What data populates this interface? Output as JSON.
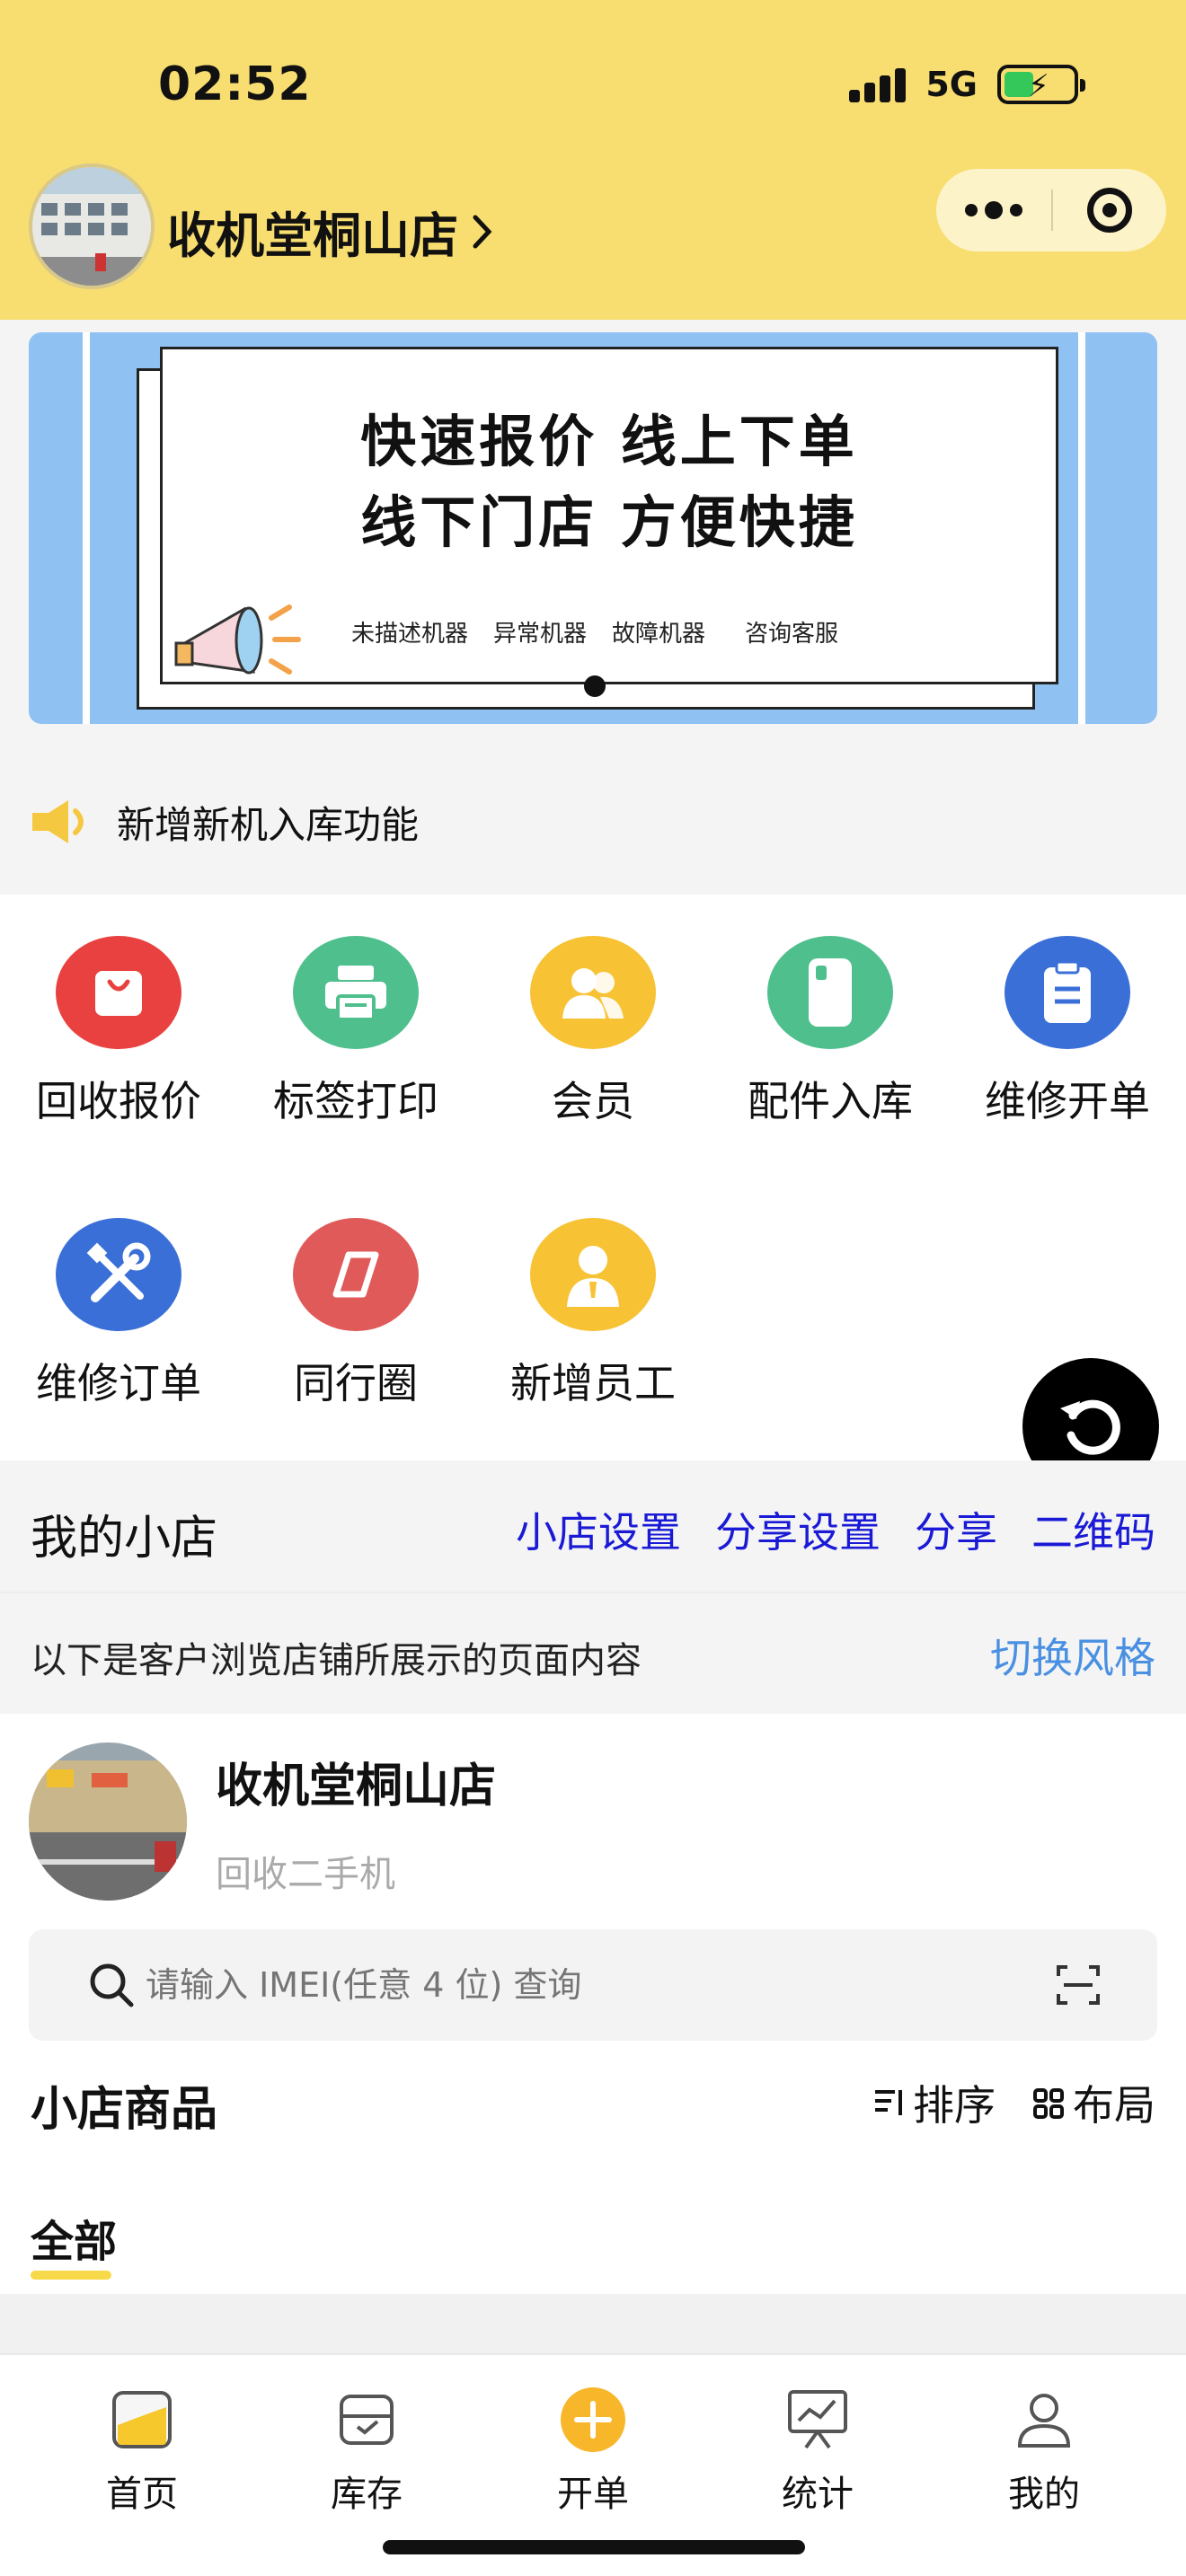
{
  "status_bar": {
    "time": "02:52",
    "network": "5G"
  },
  "header": {
    "store_name": "收机堂桐山店",
    "chevron": "›"
  },
  "banner": {
    "line1": "快速报价  线上下单",
    "line2": "线下门店  方便快捷",
    "tags": [
      "未描述机器",
      "异常机器",
      "故障机器",
      "咨询客服"
    ]
  },
  "notice": {
    "text": "新增新机入库功能",
    "icon": "speaker-icon"
  },
  "grid": {
    "items": [
      {
        "label": "回收报价",
        "icon": "bag-icon",
        "color": "#e8413f"
      },
      {
        "label": "标签打印",
        "icon": "printer-icon",
        "color": "#4fbf8d"
      },
      {
        "label": "会员",
        "icon": "members-icon",
        "color": "#f7c234"
      },
      {
        "label": "配件入库",
        "icon": "phone-icon",
        "color": "#4fbf8d"
      },
      {
        "label": "维修开单",
        "icon": "clipboard-icon",
        "color": "#3a6fd8"
      },
      {
        "label": "维修订单",
        "icon": "tools-icon",
        "color": "#3a6fd8"
      },
      {
        "label": "同行圈",
        "icon": "compass-icon",
        "color": "#e05a5a"
      },
      {
        "label": "新增员工",
        "icon": "staff-icon",
        "color": "#f7c234"
      }
    ]
  },
  "my_shop": {
    "title": "我的小店",
    "links": [
      "小店设置",
      "分享设置",
      "分享",
      "二维码"
    ],
    "note": "以下是客户浏览店铺所展示的页面内容",
    "switch_style": "切换风格"
  },
  "shop_preview": {
    "name": "收机堂桐山店",
    "subtitle": "回收二手机",
    "search_placeholder": "请输入 IMEI(任意 4 位) 查询",
    "goods_title": "小店商品",
    "sort_label": "排序",
    "layout_label": "布局",
    "tab_all": "全部"
  },
  "tabbar": {
    "items": [
      {
        "label": "首页",
        "icon": "home-icon"
      },
      {
        "label": "库存",
        "icon": "inventory-icon"
      },
      {
        "label": "开单",
        "icon": "plus-icon"
      },
      {
        "label": "统计",
        "icon": "chart-icon"
      },
      {
        "label": "我的",
        "icon": "user-icon"
      }
    ]
  },
  "colors": {
    "header_bg": "#f8de70",
    "accent_link": "#1a1ad6",
    "tab_accent": "#f8b62b"
  }
}
